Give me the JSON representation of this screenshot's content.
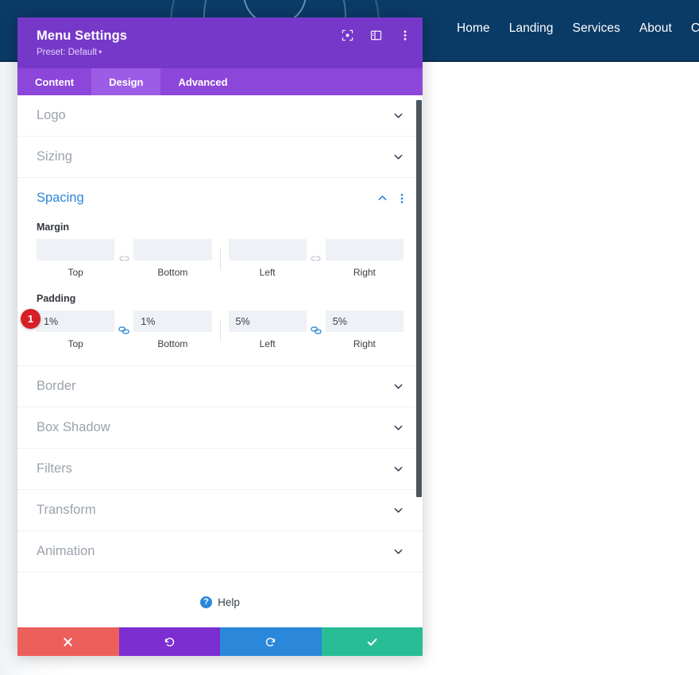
{
  "site": {
    "nav": [
      {
        "label": "Home"
      },
      {
        "label": "Landing"
      },
      {
        "label": "Services"
      },
      {
        "label": "About"
      },
      {
        "label": "Con"
      }
    ],
    "header_color": "#0a3a66"
  },
  "modal": {
    "title": "Menu Settings",
    "preset": "Preset: Default",
    "preset_caret": "▾",
    "header_color": "#7638c9",
    "icons": [
      {
        "name": "fullscreen-icon"
      },
      {
        "name": "split-view-icon"
      },
      {
        "name": "more-options-icon"
      }
    ],
    "tabs": [
      {
        "label": "Content",
        "active": false
      },
      {
        "label": "Design",
        "active": true
      },
      {
        "label": "Advanced",
        "active": false
      }
    ],
    "sections": [
      {
        "id": "logo",
        "label": "Logo",
        "open": false
      },
      {
        "id": "sizing",
        "label": "Sizing",
        "open": false
      },
      {
        "id": "spacing",
        "label": "Spacing",
        "open": true
      },
      {
        "id": "border",
        "label": "Border",
        "open": false
      },
      {
        "id": "box_shadow",
        "label": "Box Shadow",
        "open": false
      },
      {
        "id": "filters",
        "label": "Filters",
        "open": false
      },
      {
        "id": "transform",
        "label": "Transform",
        "open": false
      },
      {
        "id": "animation",
        "label": "Animation",
        "open": false
      }
    ],
    "spacing": {
      "margin": {
        "label": "Margin",
        "linked": false,
        "fields": [
          {
            "key": "top",
            "sublabel": "Top",
            "value": "",
            "placeholder": ""
          },
          {
            "key": "bottom",
            "sublabel": "Bottom",
            "value": "",
            "placeholder": ""
          },
          {
            "key": "left",
            "sublabel": "Left",
            "value": "",
            "placeholder": ""
          },
          {
            "key": "right",
            "sublabel": "Right",
            "value": "",
            "placeholder": ""
          }
        ]
      },
      "padding": {
        "label": "Padding",
        "linked": true,
        "badge": "1",
        "fields": [
          {
            "key": "top",
            "sublabel": "Top",
            "value": "1%",
            "placeholder": ""
          },
          {
            "key": "bottom",
            "sublabel": "Bottom",
            "value": "1%",
            "placeholder": ""
          },
          {
            "key": "left",
            "sublabel": "Left",
            "value": "5%",
            "placeholder": ""
          },
          {
            "key": "right",
            "sublabel": "Right",
            "value": "5%",
            "placeholder": ""
          }
        ]
      }
    },
    "help": {
      "label": "Help",
      "icon_glyph": "?"
    },
    "footer": [
      {
        "name": "cancel-button",
        "icon": "close-icon",
        "color": "#ec5f5b"
      },
      {
        "name": "undo-button",
        "icon": "undo-icon",
        "color": "#7c2ed1"
      },
      {
        "name": "redo-button",
        "icon": "redo-icon",
        "color": "#2b87da"
      },
      {
        "name": "save-button",
        "icon": "check-icon",
        "color": "#29bd96"
      }
    ]
  }
}
